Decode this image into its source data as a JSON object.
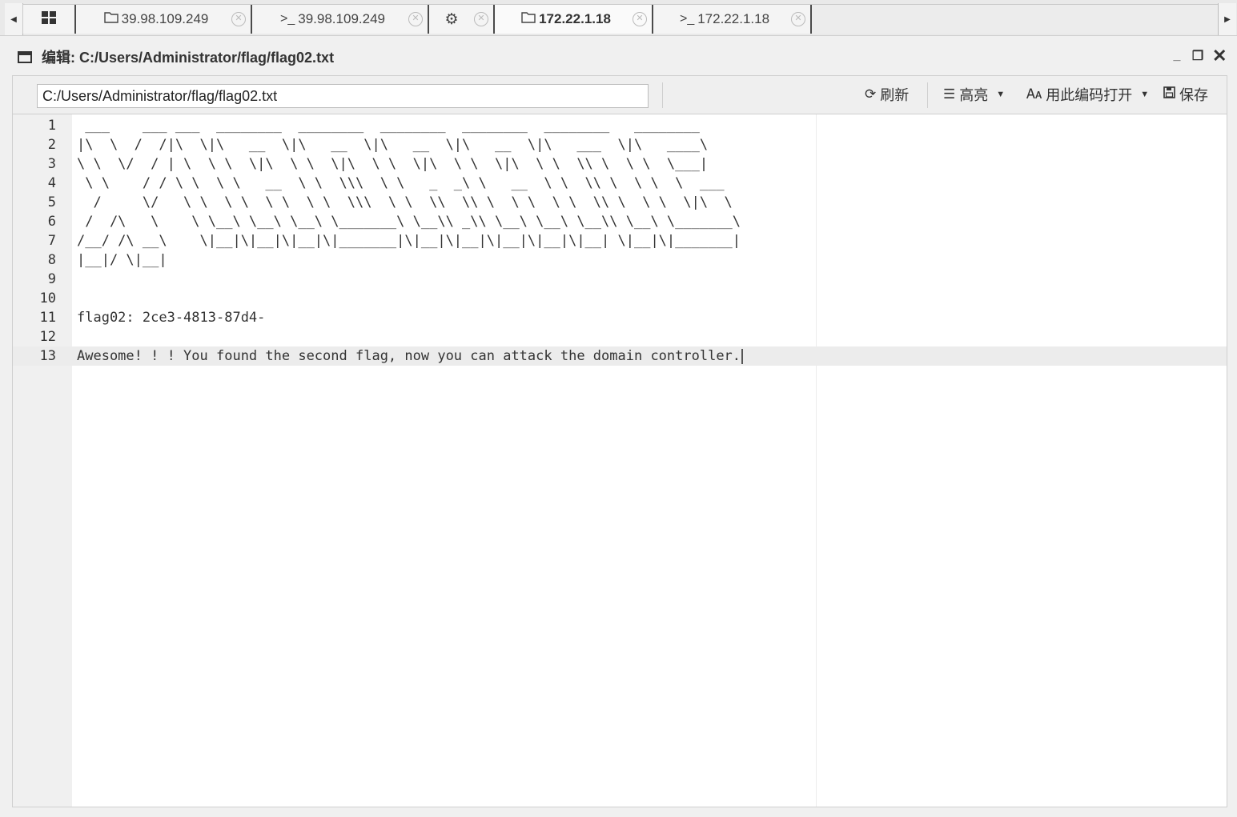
{
  "tabs": [
    {
      "icon": "grid-icon",
      "label": ""
    },
    {
      "icon": "folder-icon",
      "label": "39.98.109.249"
    },
    {
      "icon": "terminal-icon",
      "label": "39.98.109.249"
    },
    {
      "icon": "gear-icon",
      "label": ""
    },
    {
      "icon": "folder-icon",
      "label": "172.22.1.18",
      "active": true
    },
    {
      "icon": "terminal-icon",
      "label": "172.22.1.18"
    }
  ],
  "window": {
    "title": "编辑: C:/Users/Administrator/flag/flag02.txt"
  },
  "toolbar": {
    "path_value": "C:/Users/Administrator/flag/flag02.txt",
    "refresh_label": "刷新",
    "highlight_label": "高亮",
    "open_with_encoding_label": "用此编码打开",
    "save_label": "保存"
  },
  "editor": {
    "active_line": 13,
    "lines": [
      {
        "n": "1",
        "text": " ___    ___ ___  ________  ________  ________  ________  ________   ________"
      },
      {
        "n": "2",
        "text": "|\\  \\  /  /|\\  \\|\\   __  \\|\\   __  \\|\\   __  \\|\\   __  \\|\\   ___  \\|\\   ____\\"
      },
      {
        "n": "3",
        "text": "\\ \\  \\/  / | \\  \\ \\  \\|\\  \\ \\  \\|\\  \\ \\  \\|\\  \\ \\  \\|\\  \\ \\  \\\\ \\  \\ \\  \\___|"
      },
      {
        "n": "4",
        "text": " \\ \\    / / \\ \\  \\ \\   __  \\ \\  \\\\\\  \\ \\   _  _\\ \\   __  \\ \\  \\\\ \\  \\ \\  \\  ___"
      },
      {
        "n": "5",
        "text": "  /     \\/   \\ \\  \\ \\  \\ \\  \\ \\  \\\\\\  \\ \\  \\\\  \\\\ \\  \\ \\  \\ \\  \\\\ \\  \\ \\  \\|\\  \\"
      },
      {
        "n": "6",
        "text": " /  /\\   \\    \\ \\__\\ \\__\\ \\__\\ \\_______\\ \\__\\\\ _\\\\ \\__\\ \\__\\ \\__\\\\ \\__\\ \\_______\\"
      },
      {
        "n": "7",
        "text": "/__/ /\\ __\\    \\|__|\\|__|\\|__|\\|_______|\\|__|\\|__|\\|__|\\|__|\\|__| \\|__|\\|_______|"
      },
      {
        "n": "8",
        "text": "|__|/ \\|__|"
      },
      {
        "n": "9",
        "text": ""
      },
      {
        "n": "10",
        "text": ""
      },
      {
        "n": "11",
        "text": "flag02: 2ce3-4813-87d4-"
      },
      {
        "n": "12",
        "text": ""
      },
      {
        "n": "13",
        "text": "Awesome! ! ! You found the second flag, now you can attack the domain controller."
      }
    ]
  }
}
